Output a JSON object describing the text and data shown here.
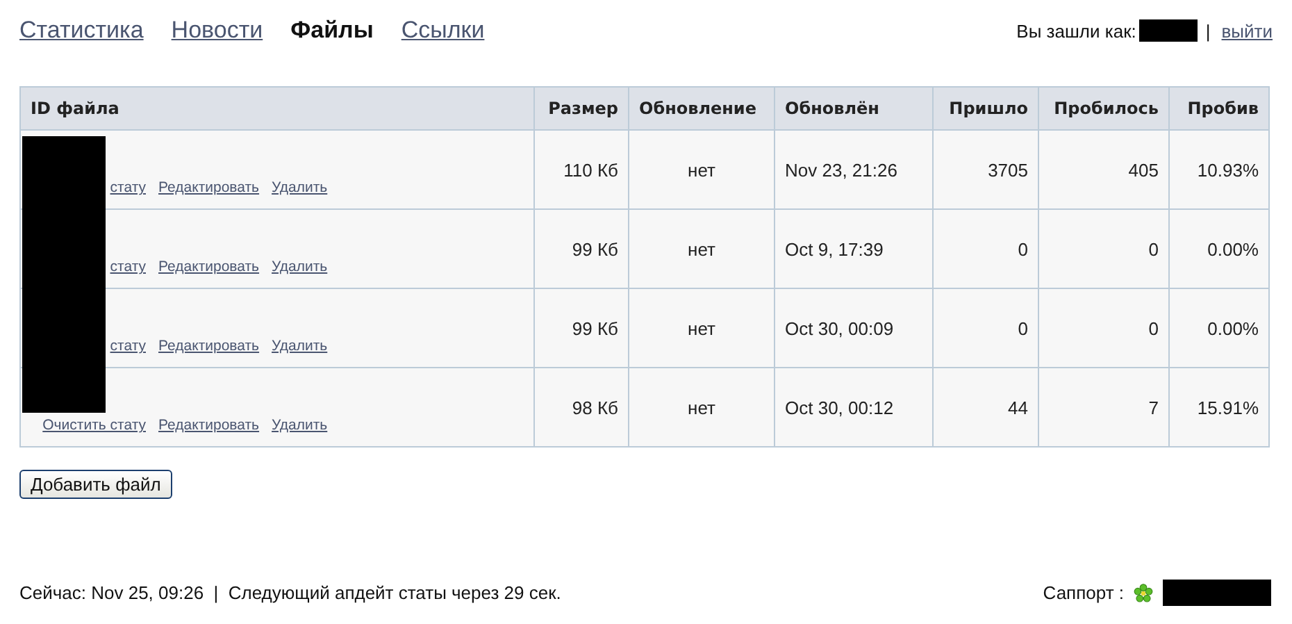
{
  "nav": [
    {
      "label": "Статистика",
      "selected": false
    },
    {
      "label": "Новости",
      "selected": false
    },
    {
      "label": "Файлы",
      "selected": true
    },
    {
      "label": "Ссылки",
      "selected": false
    }
  ],
  "user": {
    "prefix": "Вы зашли как:",
    "separator": "|",
    "logout": "выйти"
  },
  "table": {
    "columns": [
      "ID файла",
      "Размер",
      "Обновление",
      "Обновлён",
      "Пришло",
      "Пробилось",
      "Пробив"
    ],
    "rows": [
      {
        "actions": [
          "стату",
          "Редактировать",
          "Удалить"
        ],
        "size": "110 Кб",
        "update": "нет",
        "updated": "Nov 23, 21:26",
        "came": "3705",
        "passed": "405",
        "rate": "10.93%"
      },
      {
        "actions": [
          "стату",
          "Редактировать",
          "Удалить"
        ],
        "size": "99 Кб",
        "update": "нет",
        "updated": "Oct 9, 17:39",
        "came": "0",
        "passed": "0",
        "rate": "0.00%"
      },
      {
        "actions": [
          "стату",
          "Редактировать",
          "Удалить"
        ],
        "size": "99 Кб",
        "update": "нет",
        "updated": "Oct 30, 00:09",
        "came": "0",
        "passed": "0",
        "rate": "0.00%"
      },
      {
        "actions": [
          "Очистить стату",
          "Редактировать",
          "Удалить"
        ],
        "size": "98 Кб",
        "update": "нет",
        "updated": "Oct 30, 00:12",
        "came": "44",
        "passed": "7",
        "rate": "15.91%"
      }
    ]
  },
  "add_button": "Добавить файл",
  "footer": {
    "status": "Сейчас: Nov 25, 09:26  |  Следующий апдейт статы через 29 сек.",
    "support_label": "Саппорт :"
  }
}
